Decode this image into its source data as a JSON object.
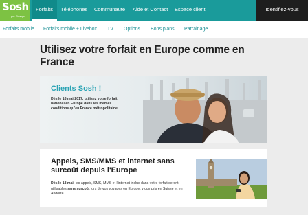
{
  "logo": {
    "word": "Sosh",
    "sub": "par Orange"
  },
  "topnav": {
    "items": [
      "Forfaits",
      "Téléphones",
      "Communauté",
      "Aide et Contact",
      "Espace client"
    ],
    "login": "Identifiez-vous"
  },
  "subnav": {
    "items": [
      "Forfaits mobile",
      "Forfaits mobile + Livebox",
      "TV",
      "Options",
      "Bons plans",
      "Parrainage"
    ]
  },
  "page": {
    "title": "Utilisez votre forfait en Europe comme en France"
  },
  "hero": {
    "title": "Clients Sosh !",
    "text": "Dès le 18 mai 2017, utilisez votre forfait national en Europe dans les mêmes conditions qu'en France métropolitaine."
  },
  "card": {
    "title": "Appels, SMS/MMS et internet sans surcoût depuis l'Europe",
    "text_lead": "Dès le 18 mai",
    "text_mid": ", les appels, SMS, MMS et l'internet inclus dans votre forfait seront utilisables ",
    "text_bold": "sans surcoût",
    "text_end": " lors de vos voyages en Europe, y compris en Suisse et en Andorre."
  },
  "colors": {
    "teal": "#1a9b9b",
    "green": "#7dc243",
    "accent_text": "#2aa3b4"
  }
}
